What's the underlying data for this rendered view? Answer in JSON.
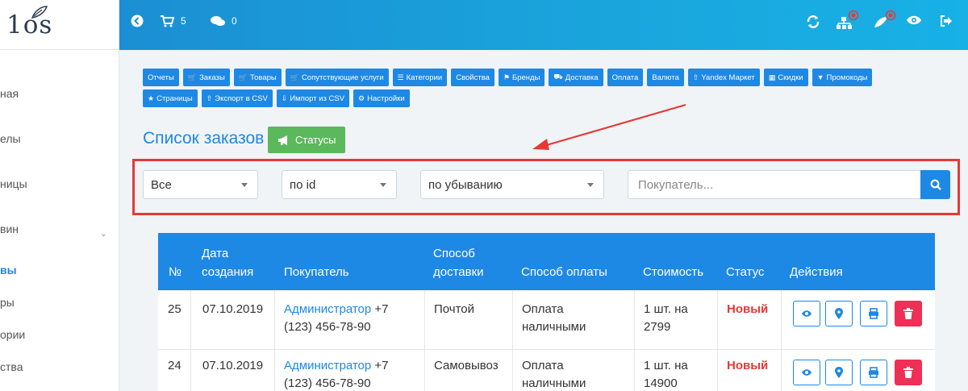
{
  "logo": "1os",
  "sidebar": {
    "items": [
      {
        "label": "ная",
        "active": false
      },
      {
        "label": "елы",
        "active": false
      },
      {
        "label": "ницы",
        "active": false
      },
      {
        "label": "вин",
        "active": false
      },
      {
        "label": "вы",
        "active": true
      },
      {
        "label": "ры",
        "active": false
      },
      {
        "label": "ории",
        "active": false
      },
      {
        "label": "ства",
        "active": false
      }
    ]
  },
  "topbar": {
    "cart_count": "5",
    "comments_count": "0"
  },
  "modules": {
    "row1": [
      {
        "label": "Отчеты",
        "icon": ""
      },
      {
        "label": "Заказы",
        "icon": "cart-icon"
      },
      {
        "label": "Товары",
        "icon": "cart-icon"
      },
      {
        "label": "Сопутствующие услуги",
        "icon": "cart-icon"
      },
      {
        "label": "Категории",
        "icon": "list-icon"
      },
      {
        "label": "Свойства",
        "icon": ""
      },
      {
        "label": "Бренды",
        "icon": "bell-icon"
      },
      {
        "label": "Доставка",
        "icon": "truck-icon"
      },
      {
        "label": "Оплата",
        "icon": ""
      },
      {
        "label": "Валюта",
        "icon": ""
      },
      {
        "label": "Yandex Маркет",
        "icon": "upload-icon"
      },
      {
        "label": "Скидки",
        "icon": "gift-icon"
      },
      {
        "label": "Промокоды",
        "icon": "trophy-icon"
      }
    ],
    "row2": [
      {
        "label": "Страницы",
        "icon": "star-icon"
      },
      {
        "label": "Экспорт в CSV",
        "icon": "upload-icon"
      },
      {
        "label": "Импорт из CSV",
        "icon": "download-icon"
      },
      {
        "label": "Настройки",
        "icon": "gear-icon"
      }
    ]
  },
  "page": {
    "title": "Список заказов",
    "status_button": "Статусы"
  },
  "filters": {
    "status": "Все",
    "sort_by": "по id",
    "order": "по убыванию",
    "search_placeholder": "Покупатель..."
  },
  "table": {
    "headers": {
      "num": "№",
      "date_1": "Дата",
      "date_2": "создания",
      "customer": "Покупатель",
      "delivery_1": "Способ",
      "delivery_2": "доставки",
      "payment": "Способ оплаты",
      "cost": "Стоимость",
      "status": "Статус",
      "actions": "Действия"
    },
    "rows": [
      {
        "num": "25",
        "date": "07.10.2019",
        "customer_name": "Администратор",
        "customer_phone_1": "+7",
        "customer_phone_2": "(123) 456-78-90",
        "delivery": "Почтой",
        "payment_1": "Оплата",
        "payment_2": "наличными",
        "cost_1": "1 шт. на",
        "cost_2": "2799",
        "status": "Новый"
      },
      {
        "num": "24",
        "date": "07.10.2019",
        "customer_name": "Администратор",
        "customer_phone_1": "+7",
        "customer_phone_2": "(123) 456-78-90",
        "delivery": "Самовывоз",
        "payment_1": "Оплата",
        "payment_2": "наличными",
        "cost_1": "1 шт. на",
        "cost_2": "14900",
        "status": "Новый"
      }
    ]
  },
  "colors": {
    "accent": "#1e88e5",
    "success": "#5cb85c",
    "danger": "#e53935",
    "delete": "#ef2f55"
  }
}
